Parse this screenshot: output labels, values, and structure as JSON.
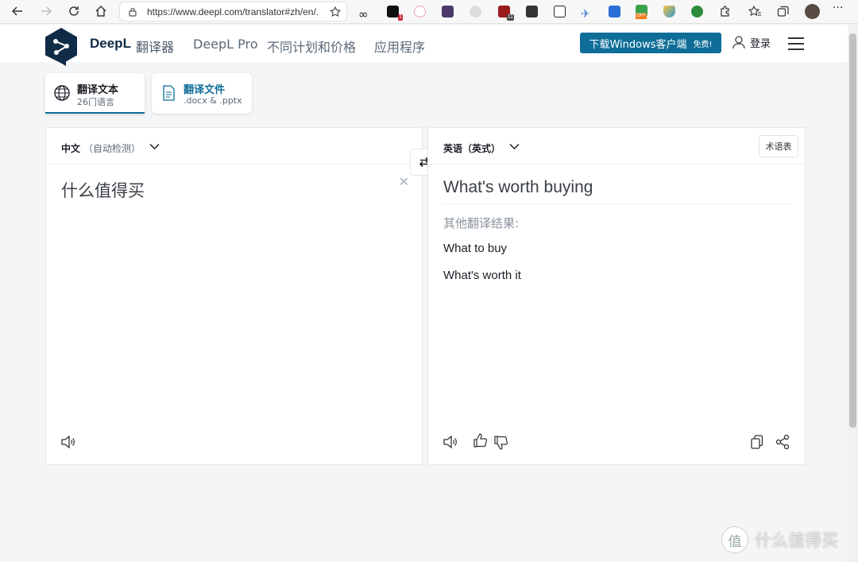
{
  "browser": {
    "url": "https://www.deepl.com/translator#zh/en/...",
    "extension_badges": [
      "1",
      "11",
      "OFF"
    ]
  },
  "header": {
    "brand": "DeepL",
    "brand_sub": "翻译器",
    "nav": [
      "DeepL Pro",
      "不同计划和价格",
      "应用程序"
    ],
    "cta_label": "下载Windows客户端",
    "cta_free": "免费!",
    "login": "登录"
  },
  "modes": [
    {
      "title": "翻译文本",
      "subtitle": "26门语言"
    },
    {
      "title": "翻译文件",
      "subtitle": ".docx & .pptx"
    }
  ],
  "source": {
    "lang": "中文",
    "lang_auto": "（自动检测）",
    "text": "什么值得买"
  },
  "target": {
    "lang": "英语（英式）",
    "glossary": "术语表",
    "text": "What's worth buying",
    "alt_title": "其他翻译结果:",
    "alternatives": [
      "What to buy",
      "What's worth it"
    ]
  },
  "watermark": {
    "glyph": "值",
    "text": "什么值得买"
  },
  "colors": {
    "accent": "#0f6e98",
    "brand_dark": "#0f2b46"
  }
}
